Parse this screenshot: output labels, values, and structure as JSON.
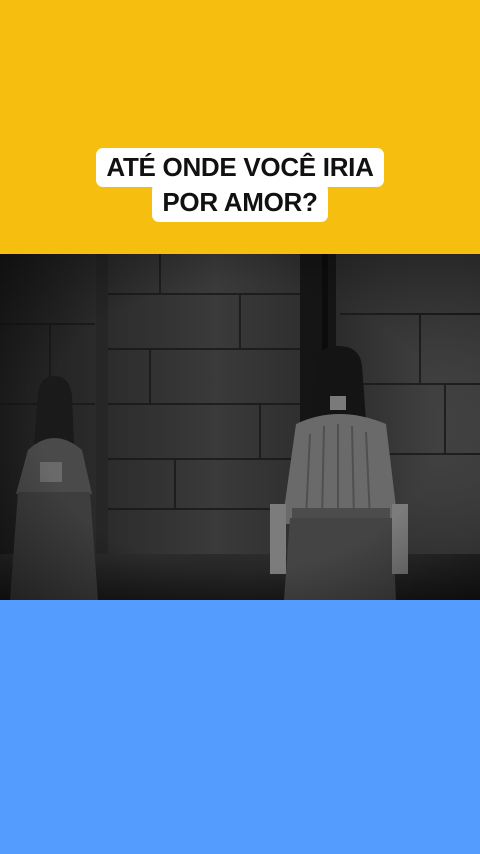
{
  "caption": {
    "line1": "ATÉ ONDE VOCÊ IRIA",
    "line2": "POR AMOR?"
  },
  "colors": {
    "top_band": "#f6bf10",
    "bottom_band": "#559cff",
    "caption_bg": "#ffffff",
    "caption_text": "#111111"
  },
  "video": {
    "description_icon": "video-still-icon",
    "grayscale": true
  }
}
